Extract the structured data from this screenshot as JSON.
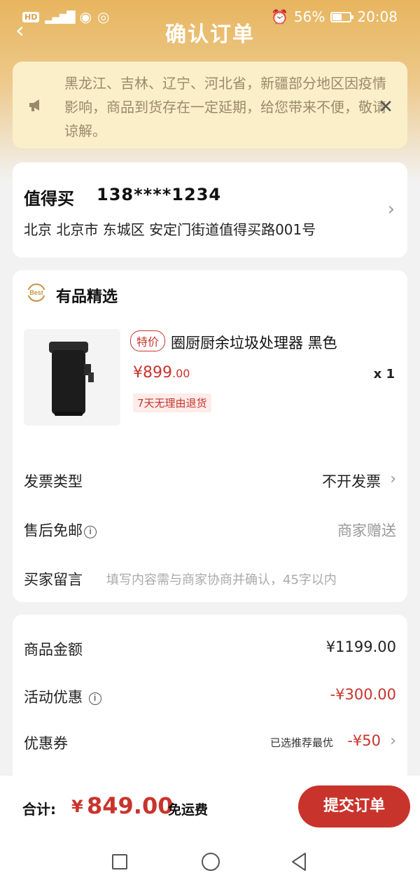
{
  "status_bar": {
    "battery": "56%",
    "time": "20:08",
    "battery_level": 0.56
  },
  "nav": {
    "title": "确认订单"
  },
  "notice": {
    "text": "黑龙江、吉林、辽宁、河北省，新疆部分地区因疫情影响，商品到货存在一定延期，给您带来不便，敬请谅解。"
  },
  "address": {
    "name": "值得买",
    "phone": "138****1234",
    "line": "北京 北京市 东城区 安定门街道值得买路001号"
  },
  "shop": {
    "name": "有品精选"
  },
  "product": {
    "tag": "特价",
    "name": "圈厨厨余垃圾处理器 黑色",
    "price_symbol": "¥",
    "price_int": "899",
    "price_dec": ".00",
    "qty": "x 1",
    "return_policy": "7天无理由退货"
  },
  "options": {
    "invoice_label": "发票类型",
    "invoice_value": "不开发票",
    "aftersale_label": "售后免邮",
    "aftersale_value": "商家赠送",
    "message_label": "买家留言",
    "message_placeholder": "填写内容需与商家协商并确认，45字以内"
  },
  "summary": {
    "goods_label": "商品金额",
    "goods_value": "¥1199.00",
    "promo_label": "活动优惠",
    "promo_value": "-¥300.00",
    "coupon_label": "优惠券",
    "coupon_hint": "已选推荐最优",
    "coupon_value": "-¥50"
  },
  "bottom": {
    "total_label": "合计:",
    "currency": "¥",
    "total_value": "849.00",
    "shipping": "免运费",
    "submit": "提交订单"
  },
  "colors": {
    "accent": "#c8342b",
    "header": "#e7b55e",
    "notice_bg": "#fbefc9"
  },
  "icons": [
    "back-icon",
    "speaker-icon",
    "close-icon",
    "chevron-right-icon",
    "info-icon",
    "best-logo-icon",
    "square-icon",
    "circle-icon",
    "triangle-back-icon"
  ]
}
